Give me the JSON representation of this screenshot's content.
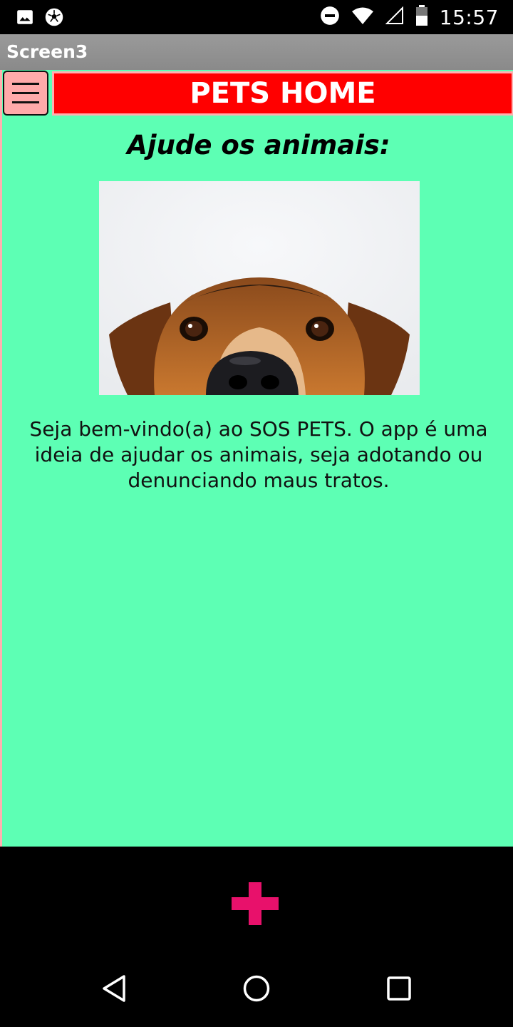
{
  "status_bar": {
    "time": "15:57",
    "left_icons": [
      "image-icon",
      "soccer-ball-icon"
    ],
    "right_icons": [
      "do-not-disturb-icon",
      "wifi-icon",
      "signal-icon",
      "battery-icon"
    ]
  },
  "app_bar": {
    "title": "Screen3"
  },
  "header": {
    "menu_icon": "hamburger-menu-icon",
    "title": "PETS HOME"
  },
  "main": {
    "heading": "Ajude os animais:",
    "image": "dog-peeking-photo",
    "description": "Seja bem-vindo(a) ao SOS PETS. O app é uma ideia de ajudar os animais, seja adotando ou denunciando maus tratos."
  },
  "fab": {
    "icon": "plus-icon",
    "color": "#e8116b"
  },
  "nav": {
    "back": "back-icon",
    "home": "home-icon",
    "recents": "recents-icon"
  },
  "colors": {
    "content_bg": "#5dffb4",
    "title_bg": "#ff0000",
    "menu_bg": "#ffaaaa"
  }
}
